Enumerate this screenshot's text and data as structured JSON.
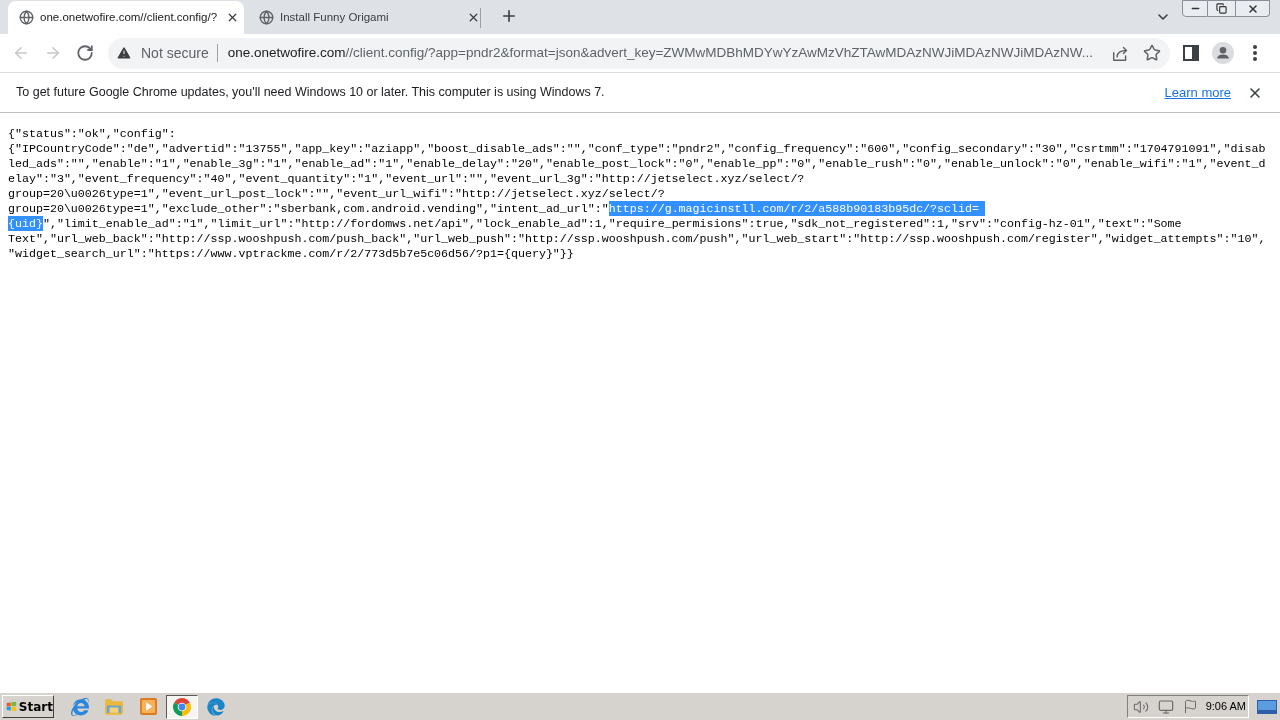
{
  "tabs": [
    {
      "title": "one.onetwofire.com//client.config/?",
      "selected": true
    },
    {
      "title": "Install Funny Origami",
      "selected": false
    }
  ],
  "toolbar": {
    "nav_buttons": [
      {
        "kind": "back",
        "disabled": true
      },
      {
        "kind": "forward",
        "disabled": true
      },
      {
        "kind": "reload",
        "disabled": false
      }
    ],
    "security_label": "Not secure",
    "url_host": "one.onetwofire.com",
    "url_path": "//client.config/?app=pndr2&format=json&advert_key=ZWMwMDBhMDYwYzAwMzVhZTAwMDAzNWJiMDAzNWJiMDAzNW..."
  },
  "infobar": {
    "message": "To get future Google Chrome updates, you'll need Windows 10 or later. This computer is using Windows 7.",
    "link": "Learn more"
  },
  "page": {
    "lines": [
      {
        "segments": [
          {
            "text": "{\"status\":\"ok\",\"config\":",
            "selected": false
          }
        ]
      },
      {
        "segments": [
          {
            "text": "{\"IPCountryCode\":\"de\",\"advertid\":\"13755\",\"app_key\":\"aziapp\",\"boost_disable_ads\":\"\",\"conf_type\":\"pndr2\",\"config_frequency\":\"600\",\"config_secondary\":\"30\",\"csrtmm\":\"1704791091\",\"disab",
            "selected": false
          }
        ]
      },
      {
        "segments": [
          {
            "text": "led_ads\":\"\",\"enable\":\"1\",\"enable_3g\":\"1\",\"enable_ad\":\"1\",\"enable_delay\":\"20\",\"enable_post_lock\":\"0\",\"enable_pp\":\"0\",\"enable_rush\":\"0\",\"enable_unlock\":\"0\",\"enable_wifi\":\"1\",\"event_d",
            "selected": false
          }
        ]
      },
      {
        "segments": [
          {
            "text": "elay\":\"3\",\"event_frequency\":\"40\",\"event_quantity\":\"1\",\"event_url\":\"\",\"event_url_3g\":\"http://jetselect.xyz/select/?",
            "selected": false
          }
        ]
      },
      {
        "segments": [
          {
            "text": "group=20\\u0026type=1\",\"event_url_post_lock\":\"\",\"event_url_wifi\":\"http://jetselect.xyz/select/?",
            "selected": false
          }
        ]
      },
      {
        "segments": [
          {
            "text": "group=20\\u0026type=1\",\"exclude_other\":\"sberbank,com.android.vending\",\"intent_ad_url\":\"",
            "selected": false
          },
          {
            "text": "https://g.magicinstll.com/r/2/a588b90183b95dc/?sclid=",
            "selected": true
          }
        ]
      },
      {
        "segments": [
          {
            "text": "{uid}",
            "selected": true
          },
          {
            "text": "\",\"limit_enable_ad\":\"1\",\"limit_url\":\"http://fordomws.net/api\",\"lock_enable_ad\":1,\"require_permisions\":true,\"sdk_not_registered\":1,\"srv\":\"config-hz-01\",\"text\":\"Some",
            "selected": false
          }
        ]
      },
      {
        "segments": [
          {
            "text": "Text\",\"url_web_back\":\"http://ssp.wooshpush.com/push_back\",\"url_web_push\":\"http://ssp.wooshpush.com/push\",\"url_web_start\":\"http://ssp.wooshpush.com/register\",\"widget_attempts\":\"10\",",
            "selected": false
          }
        ]
      },
      {
        "segments": [
          {
            "text": "\"widget_search_url\":\"https://www.vptrackme.com/r/2/773d5b7e5c06d56/?p1={query}\"}}",
            "selected": false
          }
        ]
      }
    ]
  },
  "taskbar": {
    "start": "Start",
    "apps": [
      {
        "kind": "ie",
        "selected": false
      },
      {
        "kind": "explorer",
        "selected": false
      },
      {
        "kind": "media-player",
        "selected": false
      },
      {
        "kind": "chrome",
        "selected": true
      },
      {
        "kind": "edge",
        "selected": false
      }
    ],
    "clock": "9:06 AM"
  }
}
